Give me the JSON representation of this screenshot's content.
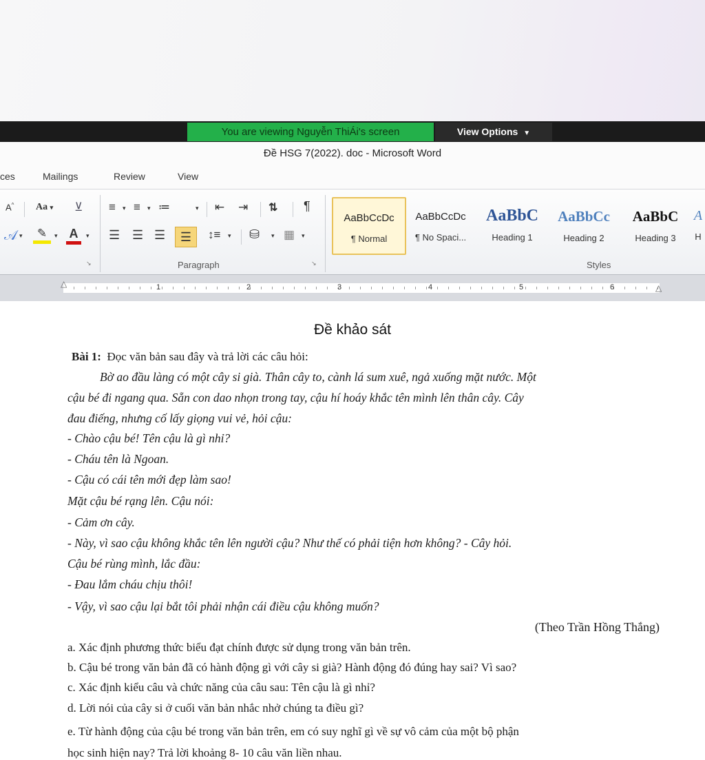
{
  "zoom_bar": {
    "notice": "You are viewing Nguyễn ThiÁi's screen",
    "view_options": "View Options",
    "view_options_icon": "chevron-down-icon"
  },
  "window": {
    "title": "Đề HSG 7(2022). doc  -  Microsoft Word"
  },
  "tabs": [
    "ces",
    "Mailings",
    "Review",
    "View"
  ],
  "ribbon": {
    "paragraph_label": "Paragraph",
    "styles_label": "Styles",
    "font_grow": "A",
    "change_case": "Aa",
    "styles": [
      {
        "sample": "AaBbCcDc",
        "name": "¶ Normal"
      },
      {
        "sample": "AaBbCcDc",
        "name": "¶ No Spaci..."
      },
      {
        "sample": "AaBbC",
        "name": "Heading 1"
      },
      {
        "sample": "AaBbCc",
        "name": "Heading 2"
      },
      {
        "sample": "AaBbC",
        "name": "Heading 3"
      },
      {
        "sample": "A",
        "name": "H"
      }
    ],
    "colors": {
      "highlight": "#f4e800",
      "font_color": "#d01010",
      "accent": "#e9c25a"
    }
  },
  "ruler": {
    "numbers": [
      "1",
      "2",
      "3",
      "4",
      "5",
      "6"
    ]
  },
  "document": {
    "title": "Đề khảo sát",
    "bai1_label": "Bài 1:",
    "bai1_text": "Đọc văn bản sau đây và trả lời các câu hỏi:",
    "passage": [
      "Bờ ao đầu làng có một cây si già. Thân cây to, cành lá sum xuê, ngả xuống mặt nước. Một",
      "cậu bé đi ngang qua. Sẵn con dao nhọn trong tay, cậu hí hoáy khắc tên mình lên thân cây. Cây",
      "đau điếng, nhưng cố lấy giọng vui vẻ, hỏi cậu:",
      "- Chào cậu bé! Tên cậu là gì nhỉ?",
      "- Cháu tên là Ngoan.",
      "- Cậu có cái tên mới đẹp làm sao!",
      "Mặt cậu bé rạng lên. Cậu nói:",
      "- Cảm ơn cây.",
      "- Này, vì sao cậu không khắc tên lên người cậu? Như thế có phải tiện hơn không? - Cây hỏi.",
      "Cậu bé rùng mình, lắc đầu:",
      "- Đau lắm cháu chịu thôi!",
      "- Vậy, vì sao cậu lại bắt tôi phải nhận cái điều cậu không muốn?"
    ],
    "source": "(Theo Trần Hồng Thắng)",
    "questions": [
      "a. Xác định phương thức biểu đạt chính được sử dụng trong văn bản trên.",
      "b. Cậu bé trong văn bản đã có hành động gì với cây si già? Hành động đó đúng hay sai? Vì sao?",
      "c. Xác định kiểu câu và chức năng của câu sau: Tên cậu là gì nhỉ?",
      "d. Lời nói của cây si ở cuối văn bản nhắc nhở chúng ta điều gì?",
      "e. Từ hành động của cậu bé trong văn bản trên, em có suy nghĩ gì về sự vô cảm của một bộ phận",
      "học sinh hiện nay? Trả lời khoảng 8- 10 câu văn liền nhau."
    ]
  }
}
